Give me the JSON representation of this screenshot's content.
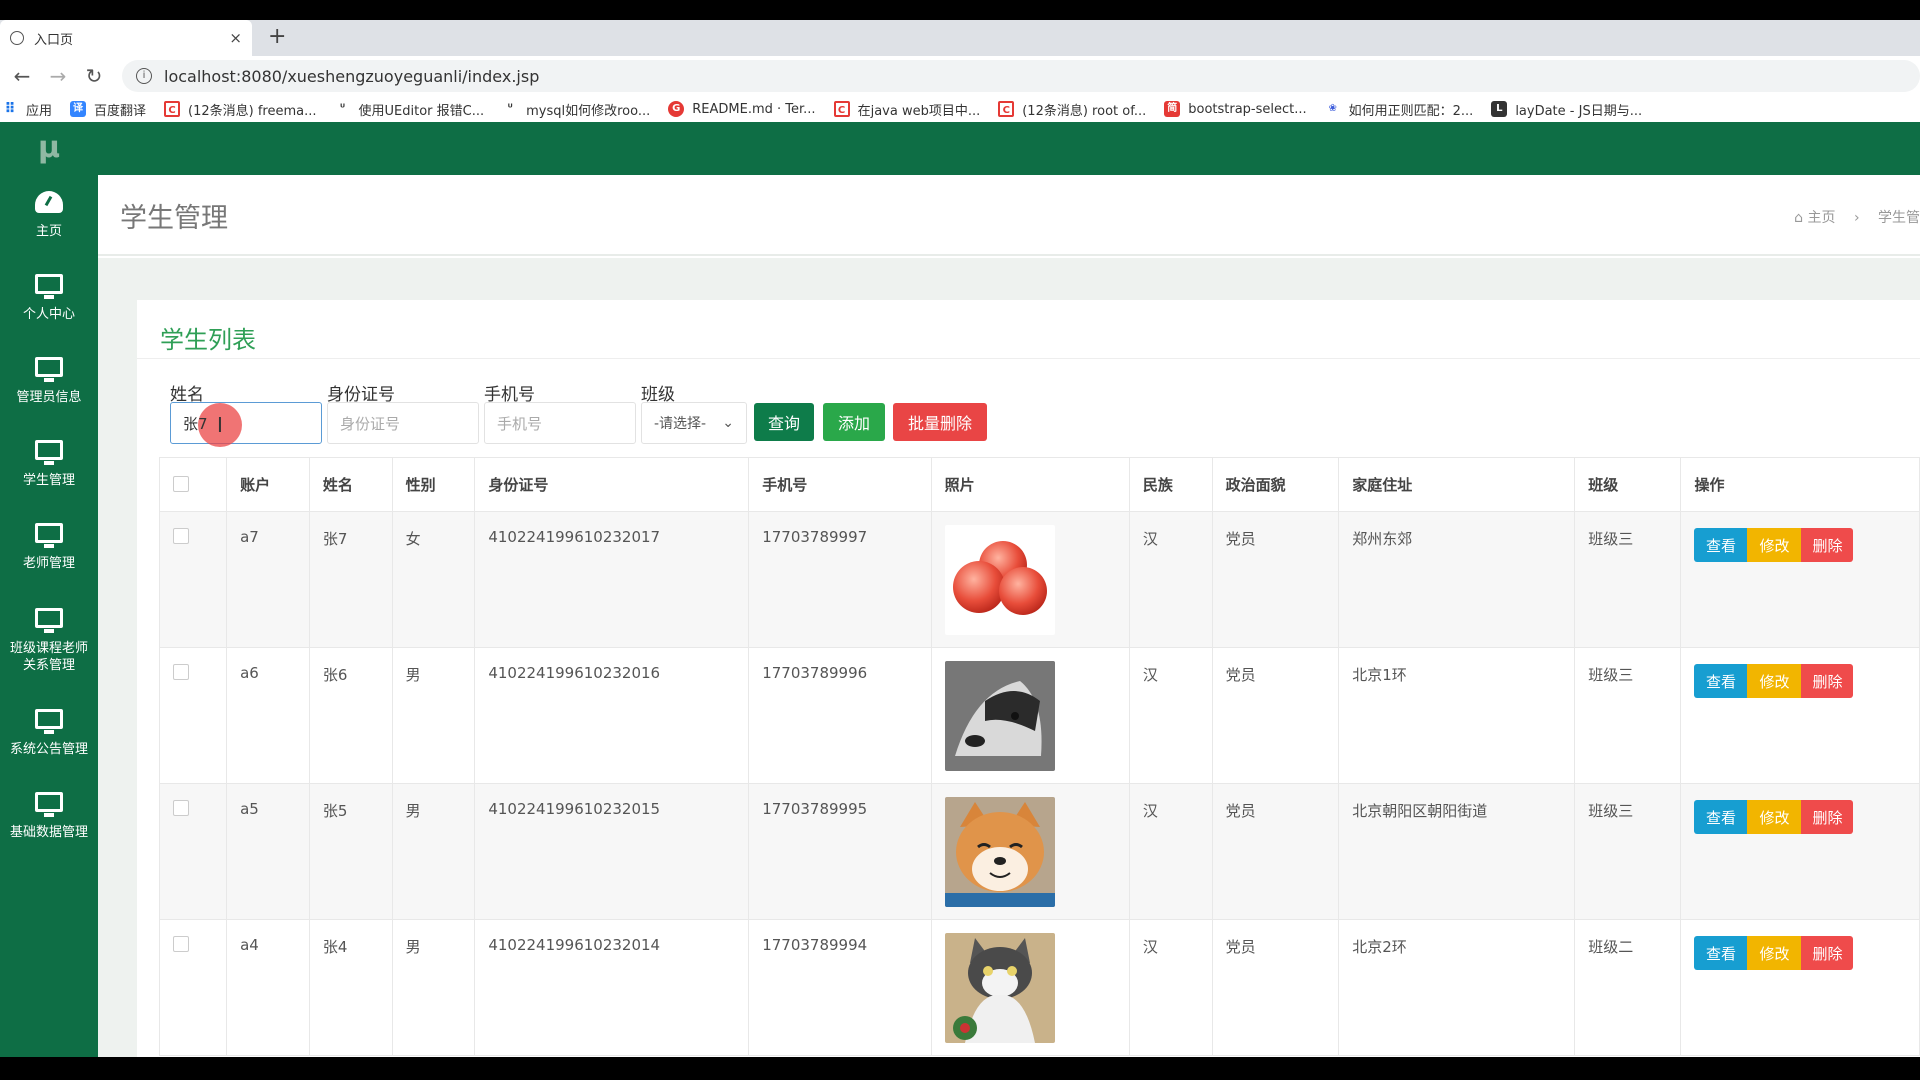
{
  "browser": {
    "tab_title": "入口页",
    "tab_close": "×",
    "new_tab": "+",
    "url": "localhost:8080/xueshengzuoyeguanli/index.jsp",
    "bookmarks": [
      {
        "icon": "apps",
        "label": "应用"
      },
      {
        "icon": "fanyi",
        "label": "百度翻译"
      },
      {
        "icon": "csdn",
        "label": "(12条消息) freema..."
      },
      {
        "icon": "ue",
        "label": "使用UEditor 报错C..."
      },
      {
        "icon": "ue",
        "label": "mysql如何修改roo..."
      },
      {
        "icon": "git",
        "label": "README.md · Ter..."
      },
      {
        "icon": "csdn",
        "label": "在java web项目中..."
      },
      {
        "icon": "csdn",
        "label": "(12条消息) root of..."
      },
      {
        "icon": "bs",
        "label": "bootstrap-select..."
      },
      {
        "icon": "baidu",
        "label": "如何用正则匹配：2..."
      },
      {
        "icon": "lay",
        "label": "layDate - JS日期与..."
      }
    ]
  },
  "sidebar": {
    "logo": "μ",
    "items": [
      {
        "icon": "dashboard-icon",
        "label": "主页"
      },
      {
        "icon": "monitor-icon",
        "label": "个人中心"
      },
      {
        "icon": "monitor-icon",
        "label": "管理员信息"
      },
      {
        "icon": "monitor-icon",
        "label": "学生管理"
      },
      {
        "icon": "monitor-icon",
        "label": "老师管理"
      },
      {
        "icon": "monitor-icon",
        "label": "班级课程老师关系管理"
      },
      {
        "icon": "monitor-icon",
        "label": "系统公告管理"
      },
      {
        "icon": "monitor-icon",
        "label": "基础数据管理"
      }
    ]
  },
  "header": {
    "title": "学生管理",
    "breadcrumb_home": "主页",
    "breadcrumb_sep": "›",
    "breadcrumb_current": "学生管"
  },
  "panel": {
    "title": "学生列表"
  },
  "filters": {
    "name_label": "姓名",
    "name_value": "张7",
    "idcard_label": "身份证号",
    "idcard_placeholder": "身份证号",
    "phone_label": "手机号",
    "phone_placeholder": "手机号",
    "class_label": "班级",
    "class_selected": "-请选择-",
    "query_label": "查询",
    "add_label": "添加",
    "batch_delete_label": "批量删除"
  },
  "table": {
    "headers": [
      "",
      "账户",
      "姓名",
      "性别",
      "身份证号",
      "手机号",
      "照片",
      "民族",
      "政治面貌",
      "家庭住址",
      "班级",
      "操作"
    ],
    "rows": [
      {
        "account": "a7",
        "name": "张7",
        "gender": "女",
        "idcard": "410224199610232017",
        "phone": "17703789997",
        "photo": "apple",
        "ethnic": "汉",
        "political": "党员",
        "address": "郑州东郊",
        "class": "班级三"
      },
      {
        "account": "a6",
        "name": "张6",
        "gender": "男",
        "idcard": "410224199610232016",
        "phone": "17703789996",
        "photo": "husky",
        "ethnic": "汉",
        "political": "党员",
        "address": "北京1环",
        "class": "班级三"
      },
      {
        "account": "a5",
        "name": "张5",
        "gender": "男",
        "idcard": "410224199610232015",
        "phone": "17703789995",
        "photo": "shiba",
        "ethnic": "汉",
        "political": "党员",
        "address": "北京朝阳区朝阳街道",
        "class": "班级三"
      },
      {
        "account": "a4",
        "name": "张4",
        "gender": "男",
        "idcard": "410224199610232014",
        "phone": "17703789994",
        "photo": "cat",
        "ethnic": "汉",
        "political": "党员",
        "address": "北京2环",
        "class": "班级二"
      }
    ],
    "actions": {
      "view": "查看",
      "edit": "修改",
      "delete": "删除"
    }
  },
  "colors": {
    "sidebar": "#0e6e45",
    "accent_green": "#2f9f56",
    "view": "#179ed1",
    "edit": "#f2b500",
    "delete": "#ef4b4b"
  }
}
